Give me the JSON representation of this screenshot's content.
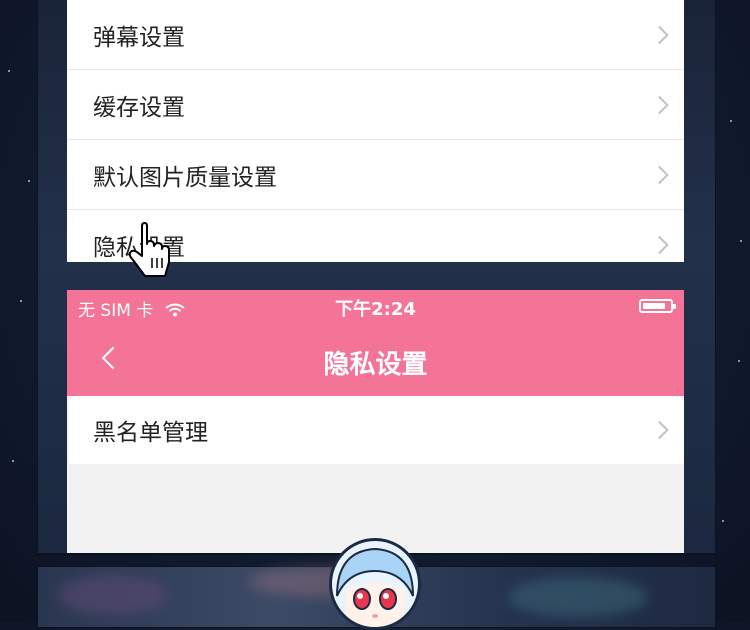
{
  "settings_list": {
    "items": [
      {
        "label": "弹幕设置"
      },
      {
        "label": "缓存设置"
      },
      {
        "label": "默认图片质量设置"
      },
      {
        "label": "隐私设置"
      }
    ]
  },
  "status_bar": {
    "carrier": "无 SIM 卡",
    "time": "下午2:24",
    "battery_level": 0.75
  },
  "nav": {
    "title": "隐私设置"
  },
  "privacy_list": {
    "items": [
      {
        "label": "黑名单管理"
      }
    ]
  },
  "colors": {
    "accent": "#f47497",
    "background": "#162238",
    "panel": "#ffffff"
  },
  "icons": [
    "chevron-right-icon",
    "wifi-icon",
    "battery-icon",
    "back-arrow-icon",
    "hand-pointer-icon"
  ]
}
